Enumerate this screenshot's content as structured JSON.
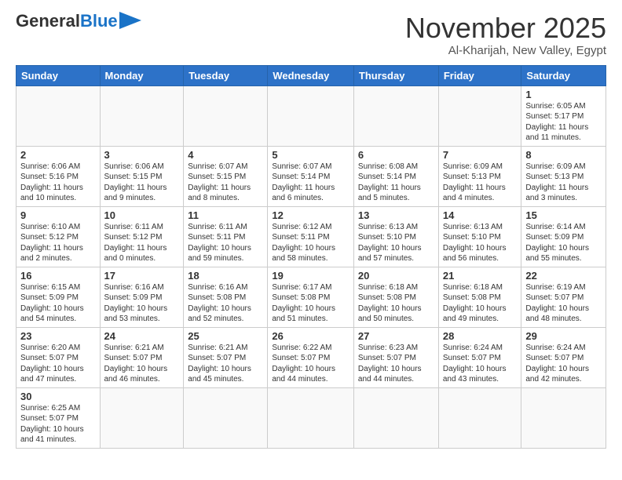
{
  "header": {
    "logo_general": "General",
    "logo_blue": "Blue",
    "main_title": "November 2025",
    "subtitle": "Al-Kharijah, New Valley, Egypt"
  },
  "days_of_week": [
    "Sunday",
    "Monday",
    "Tuesday",
    "Wednesday",
    "Thursday",
    "Friday",
    "Saturday"
  ],
  "weeks": [
    [
      {
        "day": "",
        "info": ""
      },
      {
        "day": "",
        "info": ""
      },
      {
        "day": "",
        "info": ""
      },
      {
        "day": "",
        "info": ""
      },
      {
        "day": "",
        "info": ""
      },
      {
        "day": "",
        "info": ""
      },
      {
        "day": "1",
        "info": "Sunrise: 6:05 AM\nSunset: 5:17 PM\nDaylight: 11 hours and 11 minutes."
      }
    ],
    [
      {
        "day": "2",
        "info": "Sunrise: 6:06 AM\nSunset: 5:16 PM\nDaylight: 11 hours and 10 minutes."
      },
      {
        "day": "3",
        "info": "Sunrise: 6:06 AM\nSunset: 5:15 PM\nDaylight: 11 hours and 9 minutes."
      },
      {
        "day": "4",
        "info": "Sunrise: 6:07 AM\nSunset: 5:15 PM\nDaylight: 11 hours and 8 minutes."
      },
      {
        "day": "5",
        "info": "Sunrise: 6:07 AM\nSunset: 5:14 PM\nDaylight: 11 hours and 6 minutes."
      },
      {
        "day": "6",
        "info": "Sunrise: 6:08 AM\nSunset: 5:14 PM\nDaylight: 11 hours and 5 minutes."
      },
      {
        "day": "7",
        "info": "Sunrise: 6:09 AM\nSunset: 5:13 PM\nDaylight: 11 hours and 4 minutes."
      },
      {
        "day": "8",
        "info": "Sunrise: 6:09 AM\nSunset: 5:13 PM\nDaylight: 11 hours and 3 minutes."
      }
    ],
    [
      {
        "day": "9",
        "info": "Sunrise: 6:10 AM\nSunset: 5:12 PM\nDaylight: 11 hours and 2 minutes."
      },
      {
        "day": "10",
        "info": "Sunrise: 6:11 AM\nSunset: 5:12 PM\nDaylight: 11 hours and 0 minutes."
      },
      {
        "day": "11",
        "info": "Sunrise: 6:11 AM\nSunset: 5:11 PM\nDaylight: 10 hours and 59 minutes."
      },
      {
        "day": "12",
        "info": "Sunrise: 6:12 AM\nSunset: 5:11 PM\nDaylight: 10 hours and 58 minutes."
      },
      {
        "day": "13",
        "info": "Sunrise: 6:13 AM\nSunset: 5:10 PM\nDaylight: 10 hours and 57 minutes."
      },
      {
        "day": "14",
        "info": "Sunrise: 6:13 AM\nSunset: 5:10 PM\nDaylight: 10 hours and 56 minutes."
      },
      {
        "day": "15",
        "info": "Sunrise: 6:14 AM\nSunset: 5:09 PM\nDaylight: 10 hours and 55 minutes."
      }
    ],
    [
      {
        "day": "16",
        "info": "Sunrise: 6:15 AM\nSunset: 5:09 PM\nDaylight: 10 hours and 54 minutes."
      },
      {
        "day": "17",
        "info": "Sunrise: 6:16 AM\nSunset: 5:09 PM\nDaylight: 10 hours and 53 minutes."
      },
      {
        "day": "18",
        "info": "Sunrise: 6:16 AM\nSunset: 5:08 PM\nDaylight: 10 hours and 52 minutes."
      },
      {
        "day": "19",
        "info": "Sunrise: 6:17 AM\nSunset: 5:08 PM\nDaylight: 10 hours and 51 minutes."
      },
      {
        "day": "20",
        "info": "Sunrise: 6:18 AM\nSunset: 5:08 PM\nDaylight: 10 hours and 50 minutes."
      },
      {
        "day": "21",
        "info": "Sunrise: 6:18 AM\nSunset: 5:08 PM\nDaylight: 10 hours and 49 minutes."
      },
      {
        "day": "22",
        "info": "Sunrise: 6:19 AM\nSunset: 5:07 PM\nDaylight: 10 hours and 48 minutes."
      }
    ],
    [
      {
        "day": "23",
        "info": "Sunrise: 6:20 AM\nSunset: 5:07 PM\nDaylight: 10 hours and 47 minutes."
      },
      {
        "day": "24",
        "info": "Sunrise: 6:21 AM\nSunset: 5:07 PM\nDaylight: 10 hours and 46 minutes."
      },
      {
        "day": "25",
        "info": "Sunrise: 6:21 AM\nSunset: 5:07 PM\nDaylight: 10 hours and 45 minutes."
      },
      {
        "day": "26",
        "info": "Sunrise: 6:22 AM\nSunset: 5:07 PM\nDaylight: 10 hours and 44 minutes."
      },
      {
        "day": "27",
        "info": "Sunrise: 6:23 AM\nSunset: 5:07 PM\nDaylight: 10 hours and 44 minutes."
      },
      {
        "day": "28",
        "info": "Sunrise: 6:24 AM\nSunset: 5:07 PM\nDaylight: 10 hours and 43 minutes."
      },
      {
        "day": "29",
        "info": "Sunrise: 6:24 AM\nSunset: 5:07 PM\nDaylight: 10 hours and 42 minutes."
      }
    ],
    [
      {
        "day": "30",
        "info": "Sunrise: 6:25 AM\nSunset: 5:07 PM\nDaylight: 10 hours and 41 minutes."
      },
      {
        "day": "",
        "info": ""
      },
      {
        "day": "",
        "info": ""
      },
      {
        "day": "",
        "info": ""
      },
      {
        "day": "",
        "info": ""
      },
      {
        "day": "",
        "info": ""
      },
      {
        "day": "",
        "info": ""
      }
    ]
  ]
}
